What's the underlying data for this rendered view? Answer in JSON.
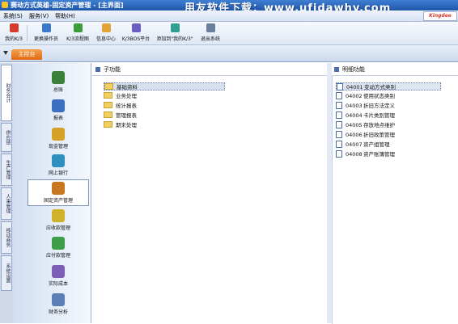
{
  "window": {
    "title": "赛动方式英雄-固定资产管理 - [主界面]",
    "watermark": "用友软件下载：www.ufidawhy.com"
  },
  "menu": {
    "items": [
      "系统(S)",
      "服务(V)",
      "帮助(H)"
    ],
    "brand": "Kingdee"
  },
  "toolbar": {
    "buttons": [
      {
        "label": "我的K/3",
        "icon": "home-icon",
        "color": "#d43c2c"
      },
      {
        "label": "更换操作员",
        "icon": "user-switch-icon",
        "color": "#3b78c9"
      },
      {
        "label": "K/3流程图",
        "icon": "flowchart-icon",
        "color": "#3a9d3a"
      },
      {
        "label": "信息中心",
        "icon": "info-center-icon",
        "color": "#e3a33a"
      },
      {
        "label": "K/3BOS平台",
        "icon": "platform-icon",
        "color": "#6a5fc1"
      },
      {
        "label": "添加到\"我的K/3\"",
        "icon": "add-favorite-icon",
        "color": "#2f9f8f"
      },
      {
        "label": "退出系统",
        "icon": "exit-icon",
        "color": "#6a7f9d"
      }
    ]
  },
  "tabs": {
    "main": "主控台"
  },
  "side_tabs": [
    "财务会计",
    "供应链",
    "生产管理",
    "人事管理",
    "移动商务",
    "系统设置"
  ],
  "modules": [
    {
      "label": "总账",
      "color": "#3a7f3a"
    },
    {
      "label": "报表",
      "color": "#3d6fbf"
    },
    {
      "label": "现金管理",
      "color": "#d4a227"
    },
    {
      "label": "网上银行",
      "color": "#2f8fbf"
    },
    {
      "label": "固定资产管理",
      "color": "#c8761f"
    },
    {
      "label": "应收款管理",
      "color": "#d1b12a"
    },
    {
      "label": "应付款管理",
      "color": "#3e9e4a"
    },
    {
      "label": "实际成本",
      "color": "#7a5fb5"
    },
    {
      "label": "财务分析",
      "color": "#5a7fb5"
    }
  ],
  "sub_functions": {
    "title": "子功能",
    "items": [
      "基础资料",
      "业务处理",
      "统计报表",
      "管理报表",
      "期末处理"
    ]
  },
  "detail_functions": {
    "title": "明细功能",
    "items": [
      {
        "code": "04001",
        "name": "变动方式类别"
      },
      {
        "code": "04002",
        "name": "使用状态类别"
      },
      {
        "code": "04003",
        "name": "折旧方法定义"
      },
      {
        "code": "04004",
        "name": "卡片类别管理"
      },
      {
        "code": "04005",
        "name": "存放地点维护"
      },
      {
        "code": "04006",
        "name": "折旧政策管理"
      },
      {
        "code": "04007",
        "name": "资产组管理"
      },
      {
        "code": "04008",
        "name": "资产账簿管理"
      }
    ]
  }
}
